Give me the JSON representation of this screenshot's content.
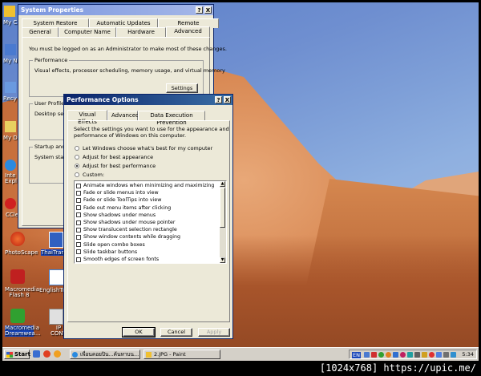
{
  "desktop": {
    "icons": [
      {
        "label": "My C",
        "color": "#f0c030"
      },
      {
        "label": "My N",
        "color": "#4a7ad0"
      },
      {
        "label": "Recy",
        "color": "#6a9ae0"
      },
      {
        "label": "My Do",
        "color": "#e8d060"
      },
      {
        "label": "Inte Expl",
        "color": "#2a8ae0"
      },
      {
        "label": "CCle",
        "color": "#d02020"
      },
      {
        "label": "PhotoScape",
        "color": "#e05a20"
      },
      {
        "label": "ThaiTrans",
        "color": "#3060c0"
      },
      {
        "label": "Macromedia Flash 8",
        "color": "#c02020"
      },
      {
        "label": "EnglishTra",
        "color": "#4080d0"
      },
      {
        "label": "Macromedia Dreamwea...",
        "color": "#30a030"
      },
      {
        "label": "IP CONTROL",
        "color": "#e0e0e0"
      }
    ]
  },
  "system_properties": {
    "title": "System Properties",
    "tabs_top": [
      "System Restore",
      "Automatic Updates",
      "Remote"
    ],
    "tabs_bottom": [
      "General",
      "Computer Name",
      "Hardware",
      "Advanced"
    ],
    "notice": "You must be logged on as an Administrator to make most of these changes.",
    "performance": {
      "title": "Performance",
      "desc": "Visual effects, processor scheduling, memory usage, and virtual memory",
      "button": "Settings"
    },
    "user_profiles": {
      "title": "User Profiles",
      "desc": "Desktop setti"
    },
    "startup": {
      "title": "Startup and R",
      "desc": "System startu"
    }
  },
  "perf_options": {
    "title": "Performance Options",
    "tabs": [
      "Visual Effects",
      "Advanced",
      "Data Execution Prevention"
    ],
    "intro_line1": "Select the settings you want to use for the appearance and",
    "intro_line2": "performance of Windows on this computer.",
    "radios": [
      {
        "label": "Let Windows choose what's best for my computer",
        "selected": false
      },
      {
        "label": "Adjust for best appearance",
        "selected": false
      },
      {
        "label": "Adjust for best performance",
        "selected": true
      },
      {
        "label": "Custom:",
        "selected": false
      }
    ],
    "effects": [
      "Animate windows when minimizing and maximizing",
      "Fade or slide menus into view",
      "Fade or slide ToolTips into view",
      "Fade out menu items after clicking",
      "Show shadows under menus",
      "Show shadows under mouse pointer",
      "Show translucent selection rectangle",
      "Show window contents while dragging",
      "Slide open combo boxes",
      "Slide taskbar buttons",
      "Smooth edges of screen fonts"
    ],
    "buttons": {
      "ok": "OK",
      "cancel": "Cancel",
      "apply": "Apply"
    },
    "help": "?",
    "close": "X"
  },
  "taskbar": {
    "start": "Start",
    "tasks": [
      "เพื่อนคอยปิน...ค้นหาบน...",
      "2.JPG - Paint"
    ],
    "lang": "EN",
    "clock": "5:34"
  },
  "footer": "[1024x768] https://upic.me/"
}
